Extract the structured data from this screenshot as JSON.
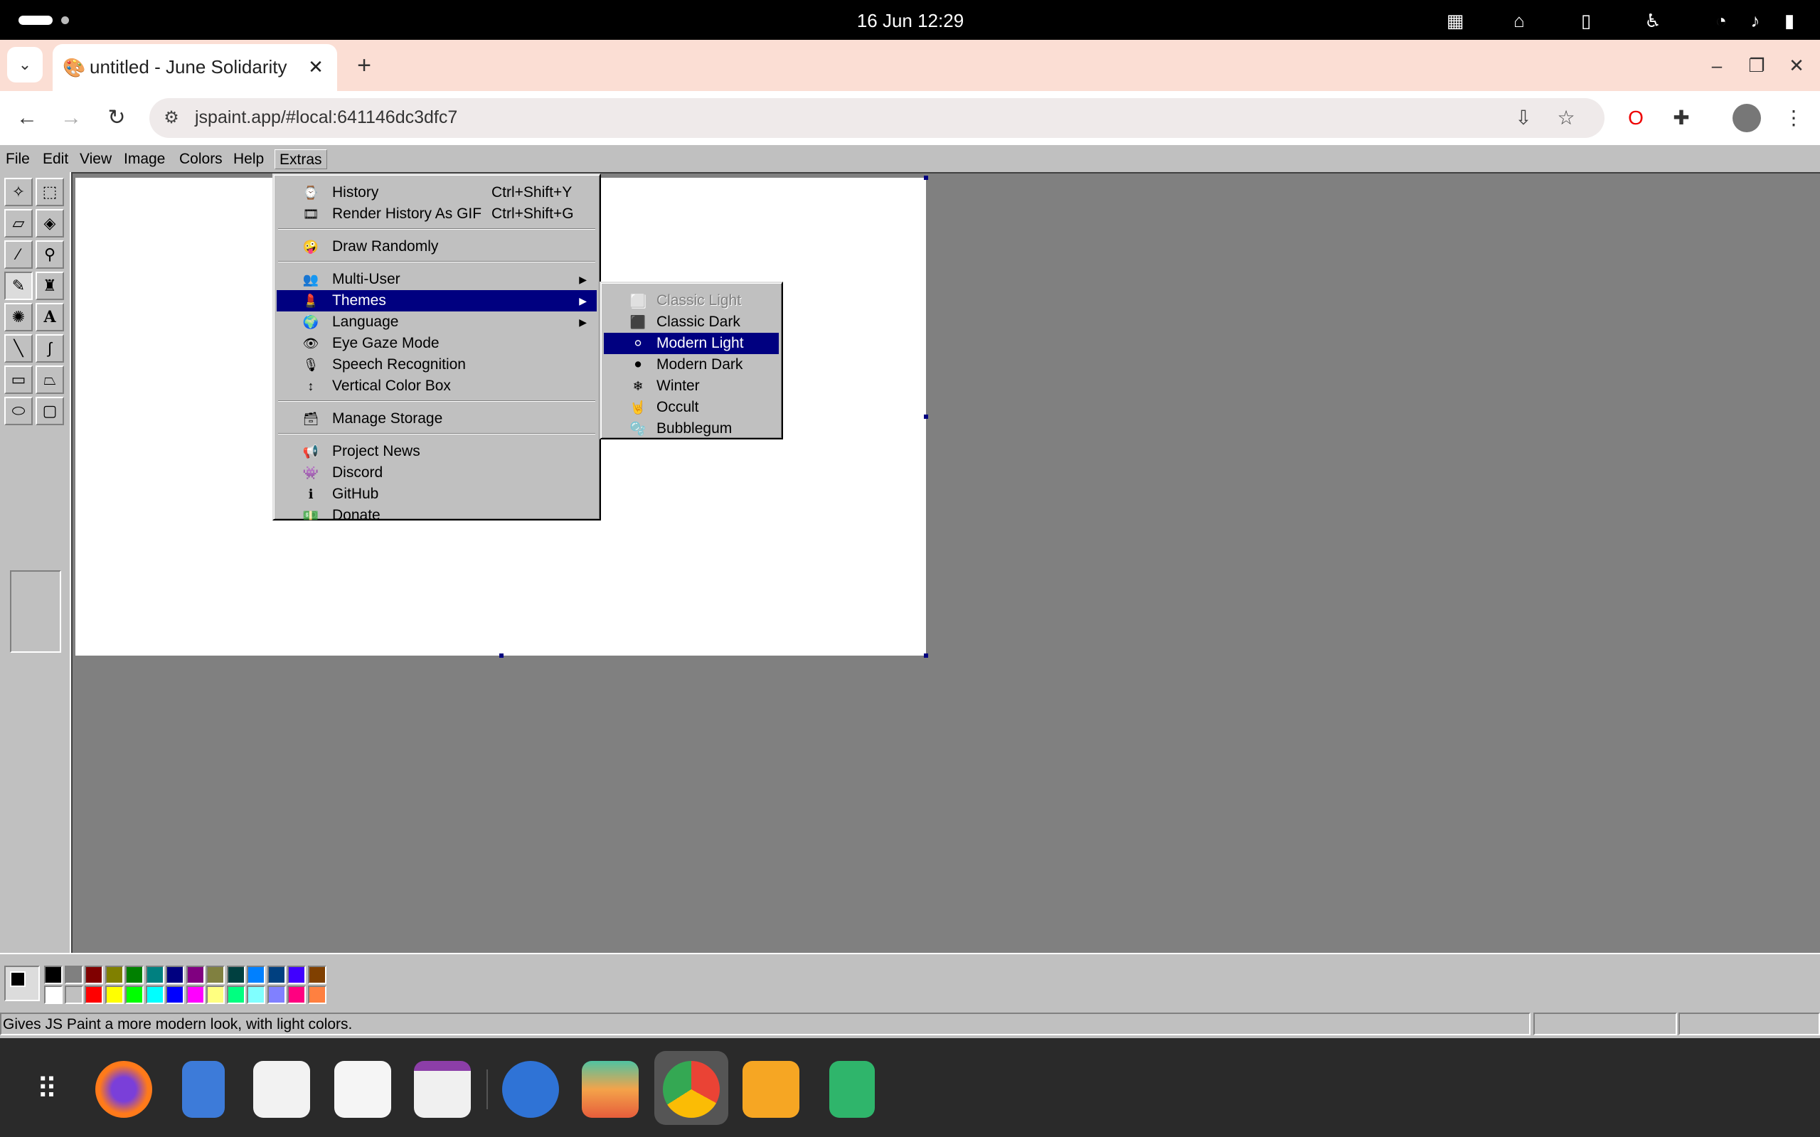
{
  "system_bar": {
    "clock": "16 Jun  12:29",
    "icons": [
      "screen-capture-icon",
      "home-icon",
      "clipboard-icon",
      "accessibility-icon",
      "wifi-icon",
      "volume-icon",
      "battery-icon"
    ]
  },
  "browser": {
    "tab_title": "untitled - June Solidarity",
    "tab_favicon": "jspaint-favicon",
    "new_tab": "+",
    "url": "jspaint.app/#local:641146dc3dfc7",
    "window_controls": [
      "minimize",
      "restore",
      "close"
    ]
  },
  "menubar": {
    "items": [
      "File",
      "Edit",
      "View",
      "Image",
      "Colors",
      "Help",
      "Extras"
    ],
    "active": "Extras"
  },
  "extras_menu": {
    "items": [
      {
        "icon": "⌚",
        "label": "History",
        "shortcut": "Ctrl+Shift+Y"
      },
      {
        "icon": "🎞",
        "label": "Render History As GIF",
        "shortcut": "Ctrl+Shift+G"
      },
      {
        "icon": "🤪",
        "label": "Draw Randomly",
        "shortcut": ""
      },
      {
        "icon": "👥",
        "label": "Multi-User",
        "shortcut": ""
      },
      {
        "icon": "💄",
        "label": "Themes",
        "shortcut": ""
      },
      {
        "icon": "🌍",
        "label": "Language",
        "shortcut": ""
      },
      {
        "icon": "👁",
        "label": "Eye Gaze Mode",
        "shortcut": ""
      },
      {
        "icon": "🎙",
        "label": "Speech Recognition",
        "shortcut": ""
      },
      {
        "icon": "↕",
        "label": "Vertical Color Box",
        "shortcut": ""
      },
      {
        "icon": "🗃",
        "label": "Manage Storage",
        "shortcut": ""
      },
      {
        "icon": "📢",
        "label": "Project News",
        "shortcut": ""
      },
      {
        "icon": "👾",
        "label": "Discord",
        "shortcut": ""
      },
      {
        "icon": "ℹ",
        "label": "GitHub",
        "shortcut": ""
      },
      {
        "icon": "💵",
        "label": "Donate",
        "shortcut": ""
      }
    ],
    "highlighted": "Themes"
  },
  "themes_submenu": {
    "items": [
      {
        "icon": "⬜",
        "label": "Classic Light",
        "disabled": true
      },
      {
        "icon": "⬛",
        "label": "Classic Dark"
      },
      {
        "icon": "⚪",
        "label": "Modern Light"
      },
      {
        "icon": "⚫",
        "label": "Modern Dark"
      },
      {
        "icon": "❄",
        "label": "Winter"
      },
      {
        "icon": "🤘",
        "label": "Occult"
      },
      {
        "icon": "🫧",
        "label": "Bubblegum"
      }
    ],
    "highlighted": "Modern Light"
  },
  "palette": {
    "row1": [
      "#000000",
      "#808080",
      "#800000",
      "#808000",
      "#008000",
      "#008080",
      "#000080",
      "#800080",
      "#808040",
      "#004040",
      "#0080ff",
      "#004080",
      "#4000ff",
      "#804000"
    ],
    "row2": [
      "#ffffff",
      "#c0c0c0",
      "#ff0000",
      "#ffff00",
      "#00ff00",
      "#00ffff",
      "#0000ff",
      "#ff00ff",
      "#ffff80",
      "#00ff80",
      "#80ffff",
      "#8080ff",
      "#ff0080",
      "#ff8040"
    ]
  },
  "status": {
    "text": "Gives JS Paint a more modern look, with light colors."
  },
  "taskbar": {
    "apps": [
      "launcher-icon",
      "firefox-icon",
      "files-icon",
      "store-icon",
      "text-editor-icon",
      "calendar-icon",
      "chromium-icon",
      "layers-app-icon",
      "chrome-icon",
      "drive-icon",
      "recycle-bin-icon"
    ]
  }
}
